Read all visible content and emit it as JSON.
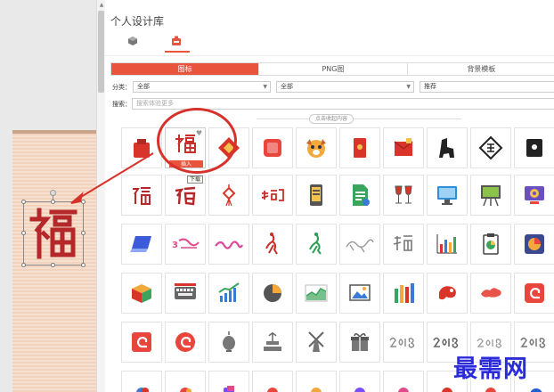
{
  "panel": {
    "title": "个人设计库",
    "tab_icons": [
      "cube-icon",
      "stamp-icon"
    ]
  },
  "tabs": [
    {
      "label": "图标",
      "active": true
    },
    {
      "label": "PNG图",
      "active": false
    },
    {
      "label": "背景模板",
      "active": false
    }
  ],
  "filters": {
    "category_label": "分类：",
    "select1_value": "全部",
    "select2_value": "全部",
    "sort_value": "推荐",
    "search_label": "搜索：",
    "search_placeholder": "搜索体验更多"
  },
  "expand_label": "点击收起内容",
  "hover_card": {
    "insert_label": "插入",
    "tooltip": "下载"
  },
  "canvas": {
    "selected_glyph": "福"
  },
  "icons_row1": [
    "red-bag-icon",
    "fu-character-icon",
    "red-diamond-icon",
    "red-square-icon",
    "dog-face-icon",
    "red-envelope-icon",
    "red-gift-card-icon",
    "black-dog-icon",
    "fu-diamond-icon",
    "black-envelope-icon"
  ],
  "icons_row2": [
    "fu-calligraphy-icon",
    "fu-calligraphy-2-icon",
    "chinese-knot-icon",
    "fu-text-icon",
    "phone-icon",
    "document-icon",
    "wine-glasses-icon",
    "monitor-icon",
    "easel-icon",
    "gear-screen-icon"
  ],
  "icons_row3": [
    "laptop-icon",
    "happy-text-icon",
    "pink-text-icon",
    "red-dancer-icon",
    "green-dancer-icon",
    "dragon-sketch-icon",
    "chinese-text-icon",
    "bar-chart-icon",
    "clipboard-icon",
    "pie-chart-icon"
  ],
  "icons_row4": [
    "3d-box-icon",
    "keyboard-icon",
    "growth-chart-icon",
    "pie-icon",
    "area-chart-icon",
    "image-frame-icon",
    "colored-bars-icon",
    "red-chameleon-icon",
    "red-cloud-icon",
    "red-at-icon"
  ],
  "icons_row5": [
    "red-at-2-icon",
    "red-at-3-icon",
    "lantern-icon",
    "fountain-icon",
    "windmill-icon",
    "gift-box-icon",
    "year-2018-icon",
    "year-2018-b-icon",
    "year-2018-c-icon",
    "year-2018-d-icon"
  ],
  "icons_row6": [
    "apple-icon",
    "apple-2-icon",
    "apple-3-icon",
    "apple-4-icon",
    "apple-5-icon",
    "apple-6-icon",
    "apple-7-icon",
    "apple-8-icon",
    "apple-9-icon",
    "blue-circle-icon"
  ],
  "watermark": "最需网",
  "colors": {
    "accent": "#e8543c",
    "circle": "#d6322b",
    "watermark": "#2b2bdb"
  }
}
